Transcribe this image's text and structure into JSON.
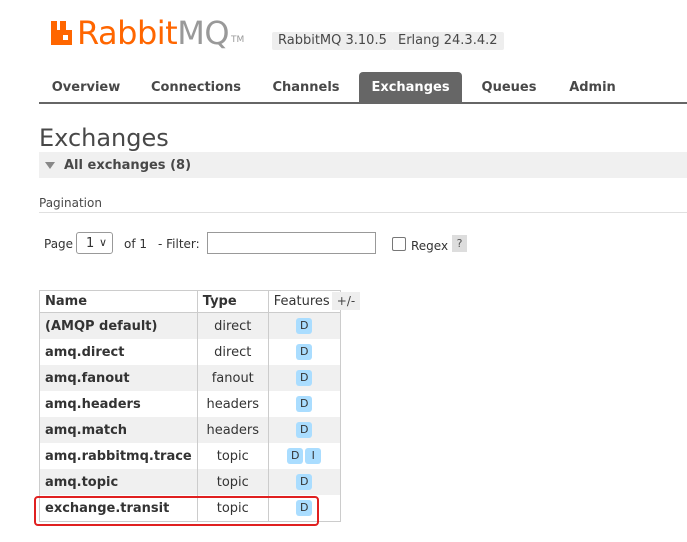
{
  "header": {
    "logo_rabbit": "Rabbit",
    "logo_mq": "MQ",
    "logo_tm": "TM",
    "version": "RabbitMQ 3.10.5",
    "erlang": "Erlang 24.3.4.2"
  },
  "nav": {
    "tabs": [
      {
        "label": "Overview"
      },
      {
        "label": "Connections"
      },
      {
        "label": "Channels"
      },
      {
        "label": "Exchanges",
        "active": true
      },
      {
        "label": "Queues"
      },
      {
        "label": "Admin"
      }
    ]
  },
  "page": {
    "title": "Exchanges",
    "section_label": "All exchanges (8)"
  },
  "pagination": {
    "heading": "Pagination",
    "page_label": "Page",
    "page_value": "1",
    "of_label": "of 1",
    "filter_label": "- Filter:",
    "filter_value": "",
    "regex_label": "Regex",
    "help_label": "?"
  },
  "table": {
    "headers": {
      "name": "Name",
      "type": "Type",
      "features": "Features"
    },
    "columns_toggle": "+/-",
    "rows": [
      {
        "name": "(AMQP default)",
        "type": "direct",
        "features": [
          "D"
        ]
      },
      {
        "name": "amq.direct",
        "type": "direct",
        "features": [
          "D"
        ]
      },
      {
        "name": "amq.fanout",
        "type": "fanout",
        "features": [
          "D"
        ]
      },
      {
        "name": "amq.headers",
        "type": "headers",
        "features": [
          "D"
        ]
      },
      {
        "name": "amq.match",
        "type": "headers",
        "features": [
          "D"
        ]
      },
      {
        "name": "amq.rabbitmq.trace",
        "type": "topic",
        "features": [
          "D",
          "I"
        ]
      },
      {
        "name": "amq.topic",
        "type": "topic",
        "features": [
          "D"
        ]
      },
      {
        "name": "exchange.transit",
        "type": "topic",
        "features": [
          "D"
        ],
        "highlighted": true
      }
    ]
  },
  "colors": {
    "brand": "#ff6600",
    "highlight": "#e02020",
    "feature_badge": "#aaddff"
  }
}
